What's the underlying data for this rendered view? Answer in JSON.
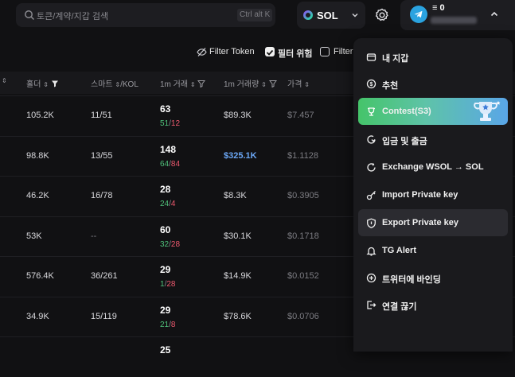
{
  "search": {
    "placeholder": "토큰/계약/지갑 검색",
    "shortcut": "Ctrl alt K"
  },
  "chain": {
    "label": "SOL"
  },
  "account": {
    "balance": "≡ 0"
  },
  "filters": {
    "filter_token": "Filter Token",
    "risk_filter": "필터 위험",
    "filter_3": "Filter"
  },
  "headers": {
    "holders": "홀더",
    "smart": "스마트",
    "kol": "/KOL",
    "tx_1m": "1m 거래",
    "vol_1m": "1m 거래량",
    "price": "가격"
  },
  "rows": [
    {
      "holders": "105.2K",
      "smart": "11/51",
      "tx": "63",
      "buys": "51",
      "sells": "12",
      "vol": "$89.3K",
      "price": "$7.457"
    },
    {
      "holders": "98.8K",
      "smart": "13/55",
      "tx": "148",
      "buys": "64",
      "sells": "84",
      "vol": "$325.1K",
      "price": "$1.1128"
    },
    {
      "holders": "46.2K",
      "smart": "16/78",
      "tx": "28",
      "buys": "24",
      "sells": "4",
      "vol": "$8.3K",
      "price": "$0.3905"
    },
    {
      "holders": "53K",
      "smart": "--",
      "tx": "60",
      "buys": "32",
      "sells": "28",
      "vol": "$30.1K",
      "price": "$0.1718"
    },
    {
      "holders": "576.4K",
      "smart": "36/261",
      "tx": "29",
      "buys": "1",
      "sells": "28",
      "vol": "$14.9K",
      "price": "$0.0152"
    },
    {
      "holders": "34.9K",
      "smart": "15/119",
      "tx": "29",
      "buys": "21",
      "sells": "8",
      "vol": "$78.6K",
      "price": "$0.0706"
    },
    {
      "tx": "25"
    }
  ],
  "menu": {
    "items": [
      {
        "label": "내 지갑",
        "icon": "wallet-icon"
      },
      {
        "label": "추천",
        "icon": "referral-icon"
      },
      {
        "label": "Contest(S3)",
        "icon": "trophy-icon"
      },
      {
        "label": "입금 및 출금",
        "icon": "deposit-icon"
      },
      {
        "label": "Exchange WSOL → SOL",
        "icon": "exchange-icon"
      },
      {
        "label": "Import Private key",
        "icon": "key-icon"
      },
      {
        "label": "Export Private key",
        "icon": "shield-icon"
      },
      {
        "label": "TG Alert",
        "icon": "bell-icon"
      },
      {
        "label": "트위터에 바인딩",
        "icon": "plus-circle-icon"
      },
      {
        "label": "연결 끊기",
        "icon": "logout-icon"
      }
    ]
  },
  "colors": {
    "bg": "#111113",
    "buy": "#4fc27a",
    "sell": "#ef5a6f",
    "highlight": "#6ba7f5",
    "contest_start": "#45c46a",
    "contest_end": "#5aa6e8"
  }
}
